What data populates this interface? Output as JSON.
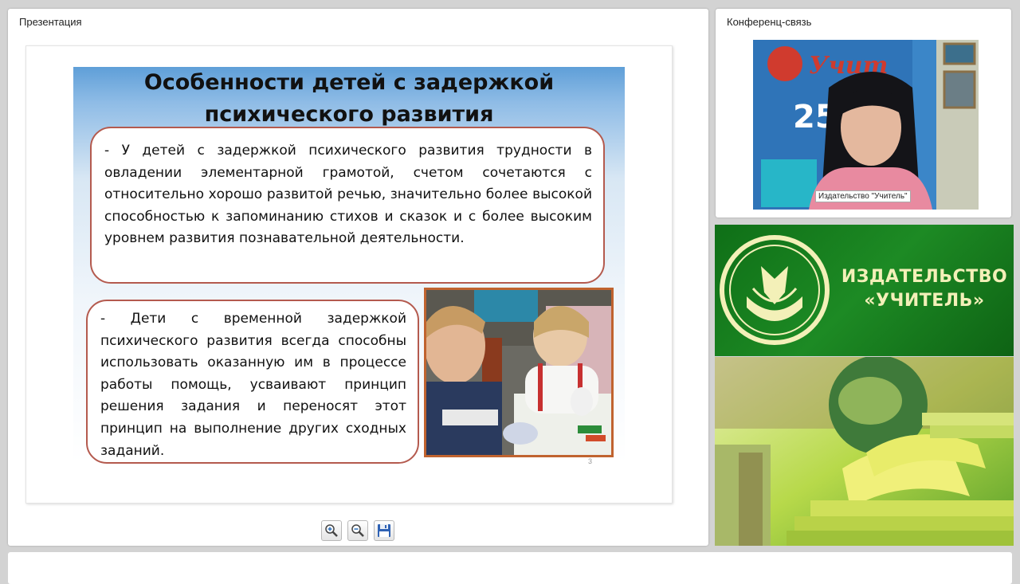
{
  "presentation": {
    "title": "Презентация",
    "slide": {
      "heading_line1": "Особенности детей с задержкой",
      "heading_line2": "психического развития",
      "paragraph1": "- У детей с задержкой психического развития трудности в овладении элементарной грамотой, счетом сочетаются с относительно хорошо развитой речью, значительно более высокой способностью к запоминанию стихов и сказок и с более высоким уровнем развития познавательной деятельности.",
      "paragraph2": "- Дети с временной задержкой психического развития всегда способны использовать оказанную им в процессе работы помощь, усваивают принцип решения задания и переносят этот принцип на выполнение других сходных заданий.",
      "page_number": "3"
    },
    "toolbar": {
      "zoom_in_icon": "zoom-in-icon",
      "zoom_out_icon": "zoom-out-icon",
      "save_icon": "floppy-disk-icon"
    }
  },
  "conference": {
    "title": "Конференц-связь",
    "participant_name": "Издательство \"Учитель\""
  },
  "banner": {
    "line1": "ИЗДАТЕЛЬСТВО",
    "line2": "«УЧИТЕЛЬ»"
  },
  "colors": {
    "banner_green": "#1d8a24",
    "banner_text": "#f3f0b8",
    "slide_box_border": "#b45a4e",
    "photo_border": "#c0632f"
  }
}
